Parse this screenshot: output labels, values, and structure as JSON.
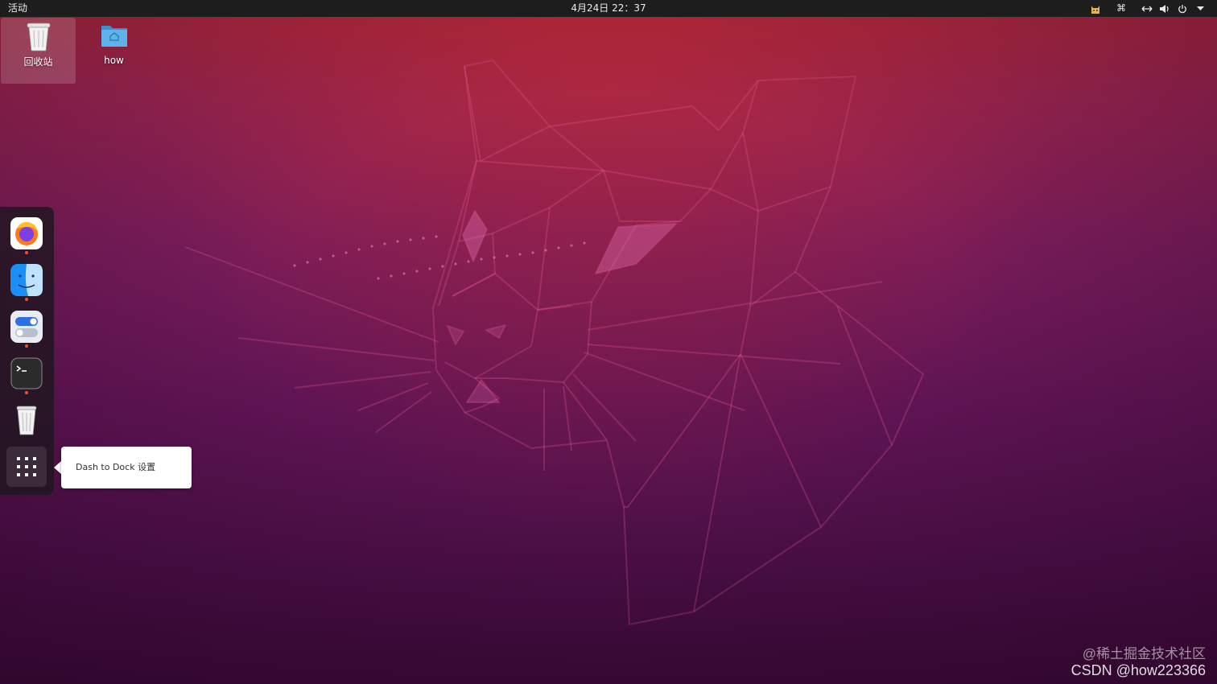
{
  "topbar": {
    "activities": "活动",
    "clock": "4月24日  22：37",
    "tray_icons": [
      "cat-tray-icon",
      "command-key-icon",
      "network-icon",
      "volume-icon",
      "power-icon",
      "chevron-down-icon"
    ]
  },
  "desktop": {
    "icons": [
      {
        "label": "回收站",
        "icon": "trash-icon",
        "selected": true
      },
      {
        "label": "how",
        "icon": "home-folder-icon",
        "selected": false
      }
    ]
  },
  "dock": {
    "apps": [
      {
        "name": "firefox",
        "icon": "firefox-icon",
        "running": true
      },
      {
        "name": "finder",
        "icon": "finder-icon",
        "running": true
      },
      {
        "name": "settings",
        "icon": "toggle-settings-icon",
        "running": true
      },
      {
        "name": "terminal",
        "icon": "terminal-icon",
        "running": true
      },
      {
        "name": "trash",
        "icon": "trash-icon",
        "running": false
      }
    ],
    "show_apps_icon": "app-grid-icon"
  },
  "tooltip": {
    "text": "Dash to Dock 设置"
  },
  "watermark": {
    "line1": "@稀土掘金技术社区",
    "line2": "CSDN @how223366"
  },
  "colors": {
    "topbar": "#1d1d1d",
    "wallpaper_top": "#b3293a",
    "wallpaper_bottom": "#3a0a36",
    "running_dot": "#e9552a"
  }
}
